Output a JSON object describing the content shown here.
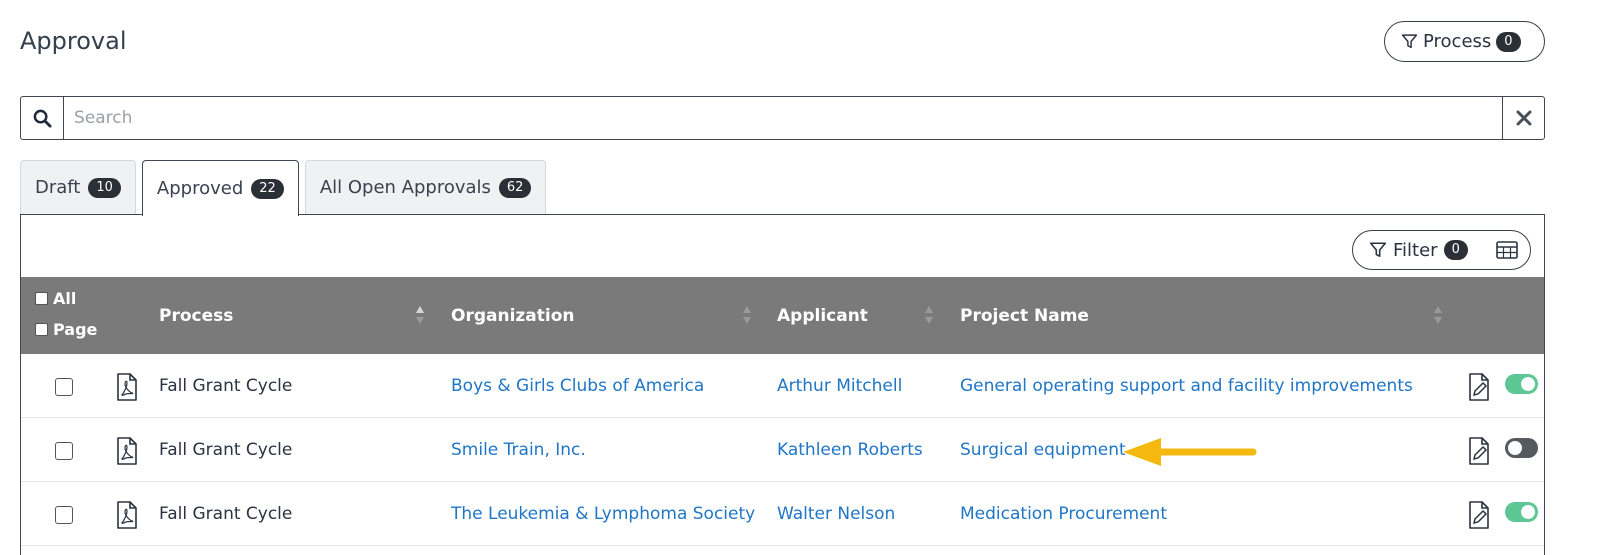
{
  "page": {
    "title": "Approval"
  },
  "process_filter": {
    "label": "Process",
    "count": "0"
  },
  "search": {
    "placeholder": "Search"
  },
  "tabs": [
    {
      "label": "Draft",
      "count": "10",
      "active": false
    },
    {
      "label": "Approved",
      "count": "22",
      "active": true
    },
    {
      "label": "All Open Approvals",
      "count": "62",
      "active": false
    }
  ],
  "table_filter": {
    "label": "Filter",
    "count": "0"
  },
  "table": {
    "select_all_label": "All",
    "select_page_label": "Page",
    "columns": [
      "Process",
      "Organization",
      "Applicant",
      "Project Name"
    ],
    "rows": [
      {
        "process": "Fall Grant Cycle",
        "organization": "Boys & Girls Clubs of America",
        "applicant": "Arthur Mitchell",
        "project": "General operating support and facility improvements",
        "enabled": true
      },
      {
        "process": "Fall Grant Cycle",
        "organization": "Smile Train, Inc.",
        "applicant": "Kathleen Roberts",
        "project": "Surgical equipment",
        "enabled": false
      },
      {
        "process": "Fall Grant Cycle",
        "organization": "The Leukemia & Lymphoma Society",
        "applicant": "Walter Nelson",
        "project": "Medication Procurement",
        "enabled": true
      }
    ]
  },
  "colors": {
    "link": "#1f76c7",
    "header_bg": "#7a7a7a",
    "toggle_on": "#5cc694",
    "toggle_off": "#555a60",
    "arrow": "#f5b80f"
  },
  "icons": [
    "funnel-icon",
    "search-icon",
    "close-icon",
    "grid-icon",
    "pdf-icon",
    "edit-document-icon",
    "sort-icon",
    "arrow-annotation"
  ]
}
